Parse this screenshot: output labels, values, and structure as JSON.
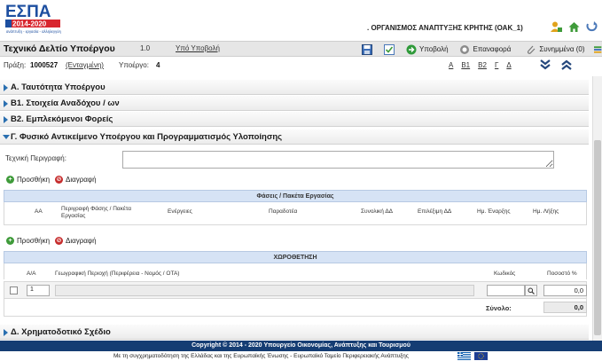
{
  "header": {
    "logo_text": "ΕΣΠΑ",
    "logo_years": "2014-2020",
    "logo_tagline": "ανάπτυξη - εργασία - αλληλεγγύη",
    "organization": ". ΟΡΓΑΝΙΣΜΟΣ ΑΝΑΠΤΥΞΗΣ ΚΡΗΤΗΣ (ΟΑΚ_1)",
    "icons": [
      "user-icon",
      "home-icon",
      "logout-icon"
    ]
  },
  "titlebar": {
    "title": "Τεχνικό Δελτίο Υποέργου",
    "version": "1.0",
    "submission_link": "Υπό Υποβολή",
    "toolbar": {
      "submit": "Υποβολή",
      "restore": "Επαναφορά",
      "attachments": "Συνημμένα (0)"
    }
  },
  "info": {
    "praxi_label": "Πράξη:",
    "praxi_value": "1000527",
    "entagmeni": "(Ενταγμένη)",
    "ypoergo_label": "Υποέργο:",
    "ypoergo_value": "4",
    "letters": [
      "Α",
      "Β1",
      "Β2",
      "Γ",
      "Δ"
    ]
  },
  "sections": {
    "a": "Α. Ταυτότητα Υποέργου",
    "b1": "Β1. Στοιχεία Αναδόχου / ων",
    "b2": "Β2. Εμπλεκόμενοι Φορείς",
    "g": "Γ. Φυσικό Αντικείμενο Υποέργου και Προγραμματισμός Υλοποίησης",
    "d": "Δ. Χρηματοδοτικό Σχέδιο"
  },
  "g_section": {
    "description_label": "Τεχνική Περιγραφή:",
    "description_value": "",
    "add_label": "Προσθήκη",
    "delete_label": "Διαγραφή",
    "phases_title": "Φάσεις / Πακέτα Εργασίας",
    "phases_columns": [
      "ΑΑ",
      "Περιγραφή Φάσης / Πακέτα Εργασίας",
      "Ενέργειες",
      "Παραδοτέα",
      "Συνολική ΔΔ",
      "Επιλέξιμη ΔΔ",
      "Ημ. Έναρξης",
      "Ημ. Λήξης"
    ],
    "location_title": "ΧΩΡΟΘΕΤΗΣΗ",
    "location_columns": [
      "Α/Α",
      "Γεωγραφική Περιοχή (Περιφέρεια - Νομός / ΟΤΑ)",
      "Κωδικός",
      "Ποσοστό %"
    ],
    "location_rows": [
      {
        "aa": "1",
        "area": "",
        "code": "",
        "percent": "0,0"
      }
    ],
    "total_label": "Σύνολο:",
    "total_value": "0,0"
  },
  "footer": {
    "copyright": "Copyright © 2014 - 2020 Υπουργείο Οικονομίας, Ανάπτυξης και Τουρισμού",
    "cofinancing": "Με τη συγχρηματοδότηση της Ελλάδας και της Ευρωπαϊκής Ένωσης - Ευρωπαϊκό Ταμείο Περιφερειακής Ανάπτυξης"
  },
  "colors": {
    "footer_bg": "#153d73",
    "grid_header_bg": "#d6e3f5",
    "section_arrow": "#2a6fb0",
    "logo_blue": "#1d4fa0",
    "logo_red": "#d8262e"
  }
}
